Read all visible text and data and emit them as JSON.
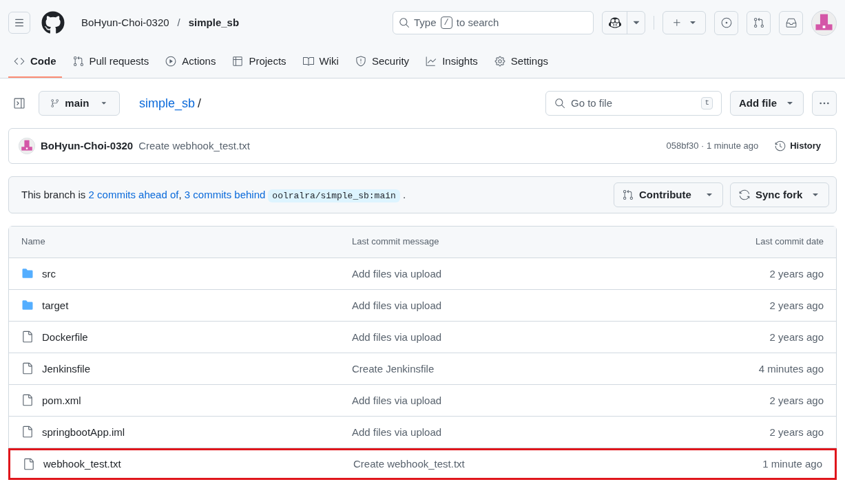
{
  "header": {
    "owner": "BoHyun-Choi-0320",
    "separator": "/",
    "repo": "simple_sb",
    "search": {
      "placeholder_before": "Type",
      "key": "/",
      "placeholder_after": "to search"
    }
  },
  "tabs": [
    {
      "label": "Code",
      "selected": true
    },
    {
      "label": "Pull requests",
      "selected": false
    },
    {
      "label": "Actions",
      "selected": false
    },
    {
      "label": "Projects",
      "selected": false
    },
    {
      "label": "Wiki",
      "selected": false
    },
    {
      "label": "Security",
      "selected": false
    },
    {
      "label": "Insights",
      "selected": false
    },
    {
      "label": "Settings",
      "selected": false
    }
  ],
  "toolbar": {
    "branch": "main",
    "path_repo": "simple_sb",
    "path_sep": "/",
    "goto_placeholder": "Go to file",
    "goto_key": "t",
    "add_file": "Add file"
  },
  "commit": {
    "author": "BoHyun-Choi-0320",
    "message": "Create webhook_test.txt",
    "meta": "058bf30 · 1 minute ago",
    "history": "History"
  },
  "branch_status": {
    "segments": [
      {
        "kind": "text",
        "text": "This branch is "
      },
      {
        "kind": "link",
        "text": "2 commits ahead of"
      },
      {
        "kind": "text",
        "text": ", "
      },
      {
        "kind": "link",
        "text": "3 commits behind"
      },
      {
        "kind": "code",
        "text": "oolralra/simple_sb:main"
      },
      {
        "kind": "text",
        "text": " ."
      }
    ],
    "contribute": "Contribute",
    "sync": "Sync fork"
  },
  "table": {
    "columns": [
      "Name",
      "Last commit message",
      "Last commit date"
    ],
    "rows": [
      {
        "kind": "folder",
        "name": "src",
        "message": "Add files via upload",
        "date": "2 years ago",
        "highlighted": false
      },
      {
        "kind": "folder",
        "name": "target",
        "message": "Add files via upload",
        "date": "2 years ago",
        "highlighted": false
      },
      {
        "kind": "file",
        "name": "Dockerfile",
        "message": "Add files via upload",
        "date": "2 years ago",
        "highlighted": false
      },
      {
        "kind": "file",
        "name": "Jenkinsfile",
        "message": "Create Jenkinsfile",
        "date": "4 minutes ago",
        "highlighted": false
      },
      {
        "kind": "file",
        "name": "pom.xml",
        "message": "Add files via upload",
        "date": "2 years ago",
        "highlighted": false
      },
      {
        "kind": "file",
        "name": "springbootApp.iml",
        "message": "Add files via upload",
        "date": "2 years ago",
        "highlighted": false
      },
      {
        "kind": "file",
        "name": "webhook_test.txt",
        "message": "Create webhook_test.txt",
        "date": "1 minute ago",
        "highlighted": true
      }
    ]
  }
}
